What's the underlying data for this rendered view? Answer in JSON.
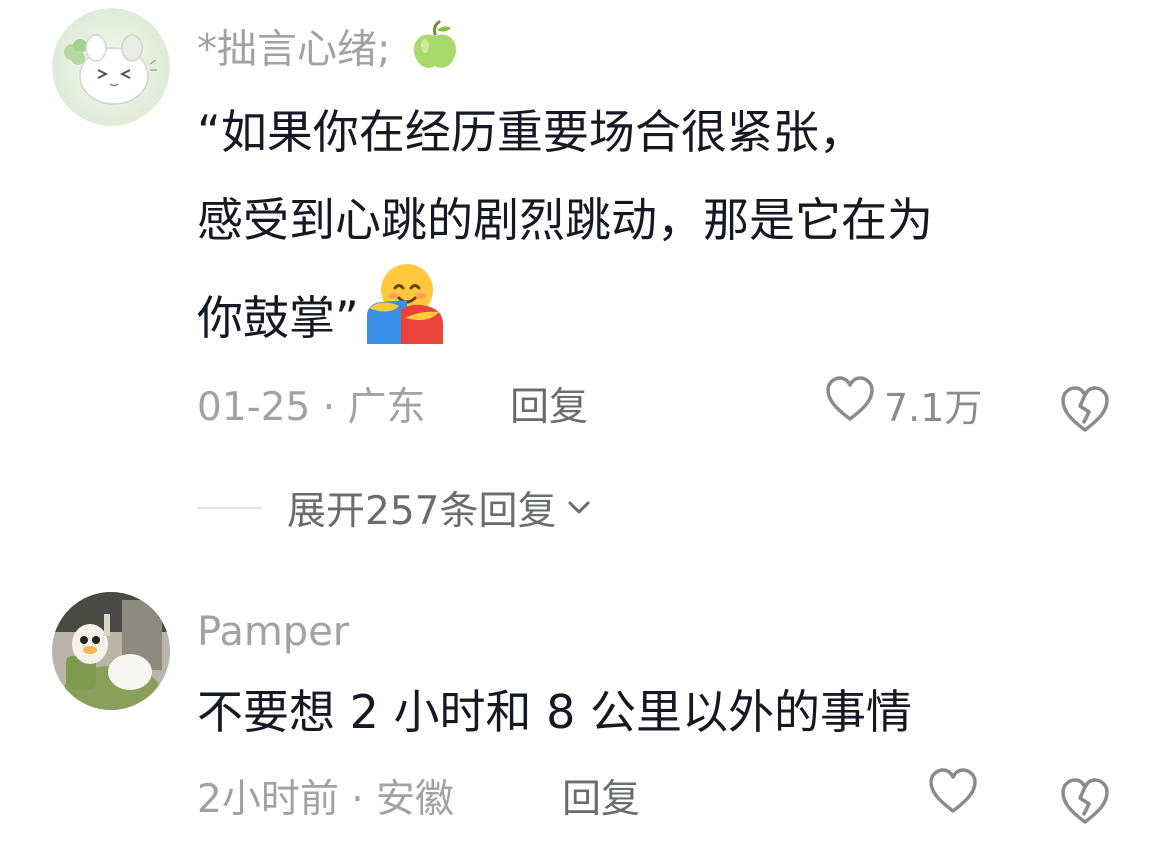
{
  "comments": [
    {
      "username": "*拙言心绪;",
      "username_emoji": "green-apple-icon",
      "text_lines": [
        "“如果你在经历重要场合很紧张，",
        "感受到心跳的剧烈跳动，那是它在为",
        "你鼓掌”"
      ],
      "text_emoji": "hugging-face-emoji",
      "date": "01-25",
      "location": "广东",
      "reply_label": "回复",
      "like_count": "7.1万",
      "expand_label": "展开257条回复"
    },
    {
      "username": "Pamper",
      "text_lines": [
        "不要想 2 小时和 8 公里以外的事情"
      ],
      "date": "2小时前",
      "location": "安徽",
      "reply_label": "回复"
    }
  ],
  "meta_separator": " · ",
  "icons": {
    "like": "heart-outline-icon",
    "dislike": "broken-heart-icon",
    "expand": "chevron-down-icon"
  },
  "colors": {
    "primary_text": "#161823",
    "secondary_text": "#a1a2a6",
    "reply_text": "#6b6c70",
    "icon": "#8a8b8f"
  }
}
